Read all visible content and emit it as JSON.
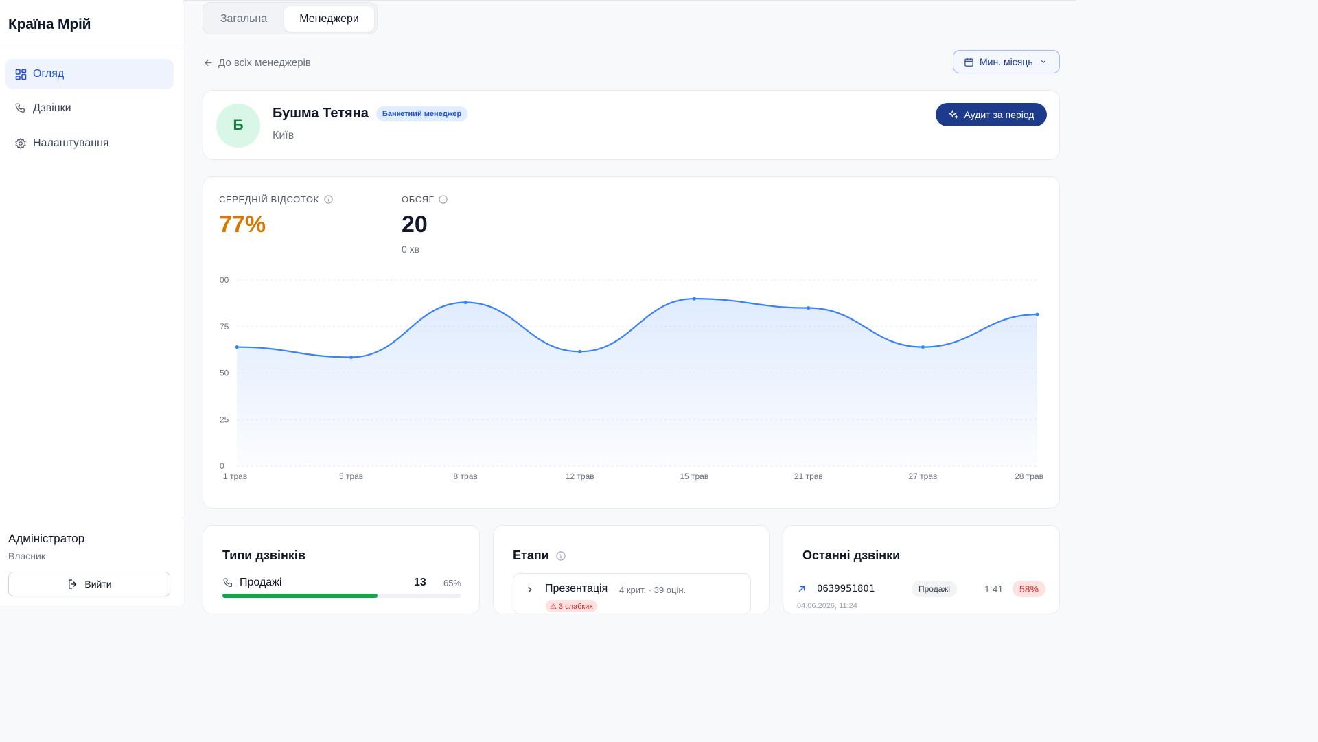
{
  "app": {
    "title": "Країна Мрій"
  },
  "sidebar": {
    "items": [
      {
        "label": "Огляд",
        "icon": "dashboard-grid-icon",
        "active": true
      },
      {
        "label": "Дзвінки",
        "icon": "phone-icon",
        "active": false
      },
      {
        "label": "Налаштування",
        "icon": "gear-icon",
        "active": false
      }
    ],
    "user": {
      "name": "Адміністратор",
      "role": "Власник"
    },
    "logout_label": "Вийти"
  },
  "tabs": [
    {
      "label": "Загальна",
      "active": false
    },
    {
      "label": "Менеджери",
      "active": true
    }
  ],
  "back_label": "До всіх менеджерів",
  "period": {
    "label": "Мин. місяць"
  },
  "manager": {
    "initial": "Б",
    "name": "Бушма Тетяна",
    "badge": "Банкетний менеджер",
    "city": "Київ",
    "audit_label": "Аудит за період"
  },
  "kpis": {
    "avg_label": "СЕРЕДНІЙ ВІДСОТОК",
    "avg_value": "77%",
    "volume_label": "ОБСЯГ",
    "volume_value": "20",
    "volume_sub": "0 хв"
  },
  "colors": {
    "accent": "#1e3a8a",
    "line": "#3b82f6",
    "avg": "#d97706",
    "bar": "#16a34a",
    "danger": "#dc2626"
  },
  "chart_data": {
    "type": "area",
    "categories": [
      "1 трав",
      "5 трав",
      "8 трав",
      "12 трав",
      "15 трав",
      "21 трав",
      "27 трав",
      "28 трав"
    ],
    "series": [
      {
        "values": [
          64,
          58.5,
          88,
          61.5,
          90,
          85,
          64,
          81.5
        ]
      }
    ],
    "y_ticks": [
      "0",
      "25",
      "50",
      "75",
      "00"
    ],
    "ylim": [
      0,
      100
    ],
    "grid": true,
    "xlabel": "",
    "ylabel": ""
  },
  "call_types": {
    "title": "Типи дзвінків",
    "items": [
      {
        "label": "Продажі",
        "count": "13",
        "percent": "65%",
        "share": 0.65
      }
    ]
  },
  "stages": {
    "title": "Етапи",
    "items": [
      {
        "name": "Презентація",
        "meta": "4 крит. · 39 оцін.",
        "errors": "⚠ 3 слабких"
      }
    ]
  },
  "recent_calls": {
    "title": "Останні дзвінки",
    "items": [
      {
        "phone": "0639951801",
        "type": "Продажі",
        "duration": "1:41",
        "score": "58%",
        "date": "04.06.2026, 11:24"
      }
    ]
  }
}
